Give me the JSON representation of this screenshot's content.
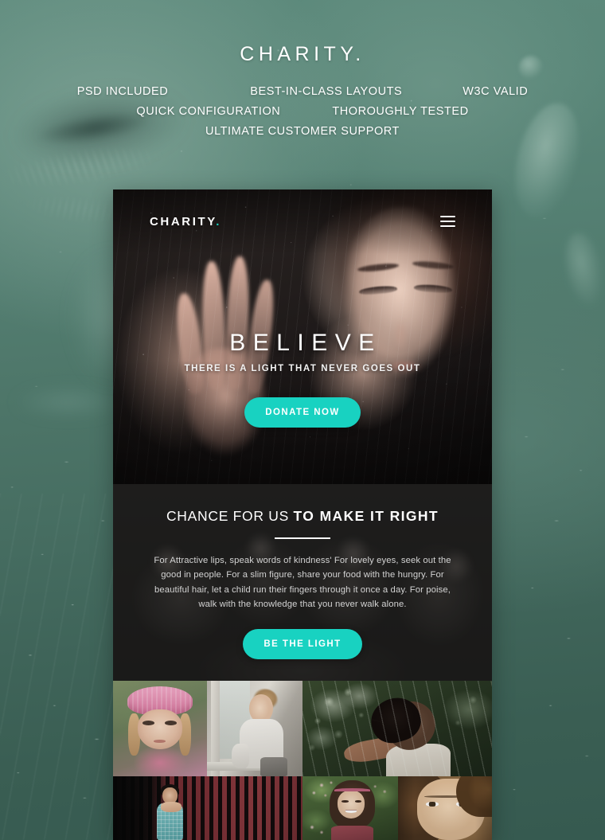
{
  "page": {
    "brand_title": "CHARITY.",
    "features": [
      [
        "PSD INCLUDED",
        "BEST-IN-CLASS LAYOUTS",
        "W3C VALID"
      ],
      [
        "QUICK CONFIGURATION",
        "THOROUGHLY TESTED"
      ],
      [
        "ULTIMATE CUSTOMER SUPPORT"
      ]
    ],
    "feature_flat": [
      "PSD INCLUDED",
      "BEST-IN-CLASS LAYOUTS",
      "W3C VALID",
      "QUICK CONFIGURATION",
      "THOROUGHLY TESTED",
      "ULTIMATE CUSTOMER SUPPORT"
    ]
  },
  "mockup": {
    "nav": {
      "logo_text": "CHARITY",
      "logo_dot": ".",
      "menu_icon": "hamburger-menu-icon"
    },
    "hero": {
      "heading": "BELIEVE",
      "subheading": "THERE IS A LIGHT THAT NEVER GOES OUT",
      "cta_label": "DONATE NOW"
    },
    "section2": {
      "title_light": "CHANCE FOR US",
      "title_bold": "TO MAKE IT RIGHT",
      "paragraph": "For Attractive lips, speak words of kindness' For lovely eyes, seek out the good in people. For a slim figure, share your food with the hungry. For beautiful hair, let a child run their fingers through it once a day. For poise, walk with the knowledge that you never walk alone.",
      "cta_label": "BE THE LIGHT"
    },
    "gallery": {
      "items": [
        {
          "alt": "girl-in-pink-knit-hat"
        },
        {
          "alt": "baby-sitting-at-window"
        },
        {
          "alt": "girl-looking-up-in-rain"
        },
        {
          "alt": "child-by-red-slat-fence"
        },
        {
          "alt": "smiling-girl-with-flowers"
        },
        {
          "alt": "close-up-girl-face"
        }
      ]
    }
  },
  "colors": {
    "accent_teal": "#18d2c1",
    "page_bg_top": "#5d8a7c",
    "page_bg_bottom": "#365a50",
    "text_white": "#ffffff",
    "section2_bg": "#232323",
    "paragraph_text": "#d3d3d3"
  }
}
